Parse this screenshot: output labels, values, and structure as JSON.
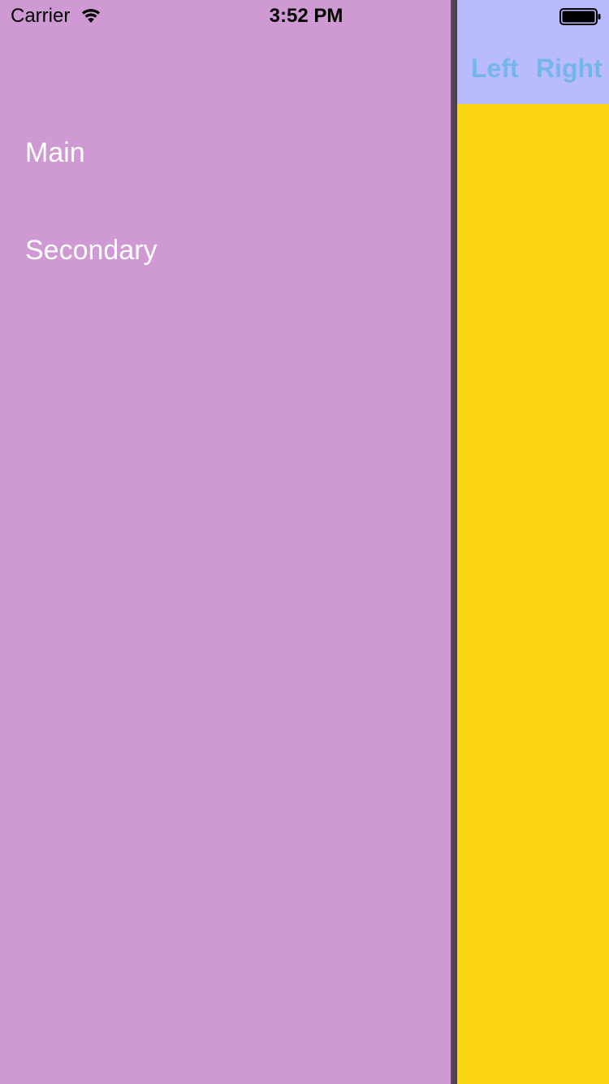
{
  "status_bar": {
    "carrier": "Carrier",
    "time": "3:52 PM",
    "wifi_icon": "wifi-icon",
    "battery_icon": "battery-icon"
  },
  "side_menu": {
    "background_color": "#cf99d3",
    "items": [
      {
        "label": "Main"
      },
      {
        "label": "Secondary"
      }
    ]
  },
  "main_panel": {
    "background_color": "#fbd611",
    "nav_bar": {
      "background_color": "#babaff",
      "left_button": "Left",
      "right_button": "Right",
      "button_color": "#74b6e6"
    }
  }
}
